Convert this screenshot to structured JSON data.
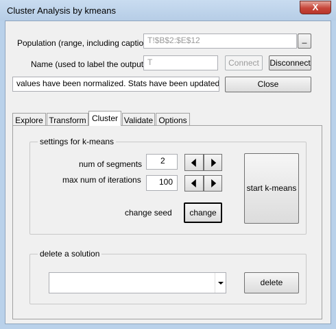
{
  "window": {
    "title": "Cluster Analysis by kmeans",
    "close_glyph": "X"
  },
  "population": {
    "label": "Population (range, including caption)",
    "value": "T!$B$2:$E$12",
    "browse_label": "_"
  },
  "name": {
    "label": "Name (used to label the output)",
    "value": "T"
  },
  "buttons": {
    "connect": "Connect",
    "disconnect": "Disconnect",
    "close": "Close"
  },
  "status": "values have been normalized. Stats have been updated",
  "tabs": [
    {
      "label": "Explore"
    },
    {
      "label": "Transform"
    },
    {
      "label": "Cluster"
    },
    {
      "label": "Validate"
    },
    {
      "label": "Options"
    }
  ],
  "active_tab": "Cluster",
  "kmeans": {
    "group_title": "settings for k-means",
    "num_segments_label": "num of segments",
    "num_segments_value": "2",
    "max_iter_label": "max num of iterations",
    "max_iter_value": "100",
    "change_seed_label": "change seed",
    "change_button": "change",
    "start_button": "start k-means"
  },
  "delete_solution": {
    "group_title": "delete a solution",
    "selected": "",
    "delete_button": "delete"
  }
}
